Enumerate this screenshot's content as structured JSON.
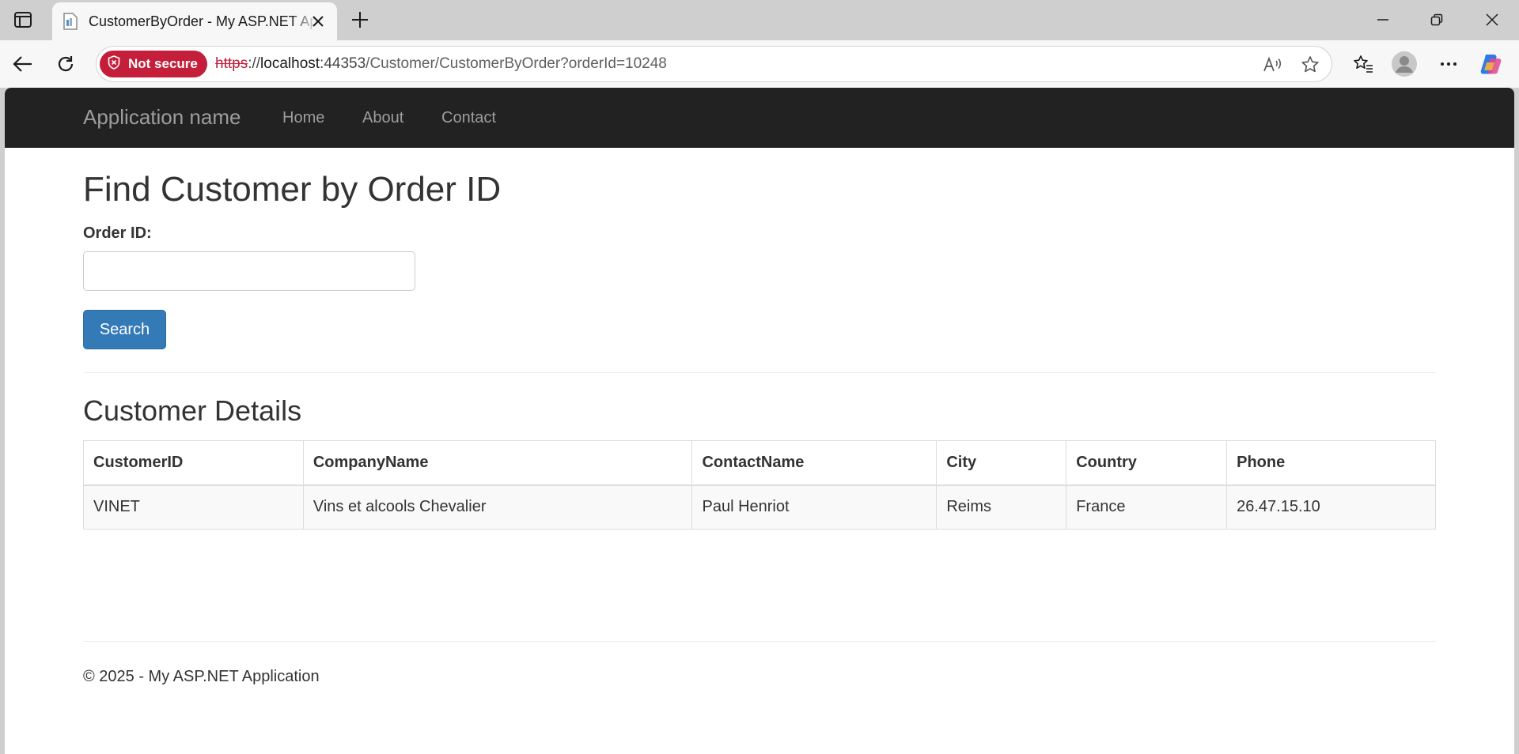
{
  "browser": {
    "tab_title": "CustomerByOrder - My ASP.NET Application",
    "security_label": "Not secure",
    "url_scheme": "https",
    "url_sep": "://",
    "url_host": "localhost",
    "url_host_tail": ":44353",
    "url_path": "/Customer/CustomerByOrder?orderId=10248"
  },
  "navbar": {
    "brand": "Application name",
    "links": [
      "Home",
      "About",
      "Contact"
    ]
  },
  "main": {
    "heading": "Find Customer by Order ID",
    "order_label": "Order ID:",
    "order_value": "",
    "search_label": "Search",
    "details_heading": "Customer Details",
    "table": {
      "headers": [
        "CustomerID",
        "CompanyName",
        "ContactName",
        "City",
        "Country",
        "Phone"
      ],
      "rows": [
        [
          "VINET",
          "Vins et alcools Chevalier",
          "Paul Henriot",
          "Reims",
          "France",
          "26.47.15.10"
        ]
      ]
    }
  },
  "footer": {
    "text": "© 2025 - My ASP.NET Application"
  },
  "colors": {
    "navbar_bg": "#222222",
    "primary_button": "#337ab7",
    "not_secure": "#c41e3a"
  }
}
